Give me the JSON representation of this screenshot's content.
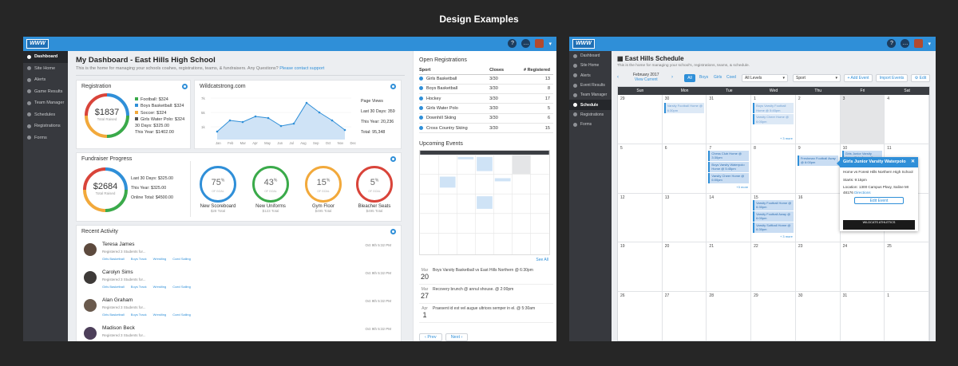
{
  "heading": "Design Examples",
  "dashboard": {
    "logo": "WWW",
    "nav": [
      {
        "label": "Dashboard",
        "active": true
      },
      {
        "label": "Site Home"
      },
      {
        "label": "Alerts"
      },
      {
        "label": "Game Results"
      },
      {
        "label": "Team Manager"
      },
      {
        "label": "Schedules"
      },
      {
        "label": "Registrations"
      },
      {
        "label": "Forms"
      }
    ],
    "title": "My Dashboard - East Hills High School",
    "subtitle": "This is the home for managing your schools coahes, registrations, teams, & fundraisers. Any Questions?",
    "subtitle_link": "Please contact support",
    "registration": {
      "title": "Registration",
      "total": "$1837",
      "total_label": "Total Raised",
      "legend": [
        {
          "label": "Football: $324",
          "color": "#3aaa4a"
        },
        {
          "label": "Boys Basketball: $324",
          "color": "#2f8fd8"
        },
        {
          "label": "Soccer: $324",
          "color": "#f2a93b"
        },
        {
          "label": "Girls Water Polo: $324",
          "color": "#555555"
        }
      ],
      "last30": "30 Days: $325.00",
      "thisyear": "This Year: $1402.00"
    },
    "wildcat": {
      "title": "Wildcatstrong.com",
      "y_ticks": [
        "7k",
        "5k",
        "1k"
      ],
      "months": [
        "Jan",
        "Feb",
        "Mar",
        "Apr",
        "May",
        "Jun",
        "Jul",
        "Aug",
        "Sep",
        "Oct",
        "Nov",
        "Dec"
      ],
      "stats_title": "Page Views",
      "stat_rows": [
        "Last 30 Days: 359",
        "This Year: 20,236",
        "Total: 95,348"
      ]
    },
    "fundraiser": {
      "title": "Fundraiser Progress",
      "total": "$2684",
      "total_label": "Total Raised",
      "rows": [
        "Last 30 Days: $325.00",
        "This Year: $325.00",
        "Online Total: $4500.00"
      ],
      "goals": [
        {
          "pct": "75",
          "name": "New Scoreboard",
          "total": "$28 Total",
          "color": "#2f8fd8"
        },
        {
          "pct": "43",
          "name": "New Uniforms",
          "total": "$123 Total",
          "color": "#3aaa4a"
        },
        {
          "pct": "15",
          "name": "Gym Floor",
          "total": "$495 Total",
          "color": "#f2a93b"
        },
        {
          "pct": "5",
          "name": "Bleacher Seats",
          "total": "$495 Total",
          "color": "#d9443a"
        }
      ],
      "of_goal": "OF GOAL",
      "pct_sign": "%"
    },
    "activity": {
      "title": "Recent Activity",
      "items": [
        {
          "name": "Teresa James",
          "desc": "Registered 3 Students for...",
          "date": "Oct 9th 5:32 PM",
          "tags": [
            "Girls Basketball",
            "Boys Track",
            "Wrestling",
            "Coed Sailing"
          ]
        },
        {
          "name": "Carolyn Sims",
          "desc": "Registered 3 Students for...",
          "date": "Oct 9th 5:32 PM",
          "tags": [
            "Girls Basketball",
            "Boys Track",
            "Wrestling",
            "Coed Sailing"
          ]
        },
        {
          "name": "Alan Graham",
          "desc": "Registered 3 Students for...",
          "date": "Oct 9th 5:32 PM",
          "tags": [
            "Girls Basketball",
            "Boys Track",
            "Wrestling",
            "Coed Sailing"
          ]
        },
        {
          "name": "Madison Beck",
          "desc": "Registered 3 Students for...",
          "date": "Oct 9th 5:32 PM",
          "tags": []
        }
      ]
    },
    "open_reg": {
      "title": "Open Registrations",
      "headers": [
        "Sport",
        "Closes",
        "# Registered"
      ],
      "rows": [
        {
          "sport": "Girls Basketball",
          "closes": "3/30",
          "count": "13"
        },
        {
          "sport": "Boys Basketball",
          "closes": "3/30",
          "count": "8"
        },
        {
          "sport": "Hockey",
          "closes": "3/30",
          "count": "17"
        },
        {
          "sport": "Girls Water Polo",
          "closes": "3/30",
          "count": "5"
        },
        {
          "sport": "Downhill Skiing",
          "closes": "3/30",
          "count": "6"
        },
        {
          "sport": "Cross Country Skiing",
          "closes": "3/30",
          "count": "15"
        }
      ]
    },
    "upcoming": {
      "title": "Upcoming Events",
      "see_all": "See All",
      "events": [
        {
          "mon": "Mar",
          "day": "20",
          "text": "Boys Varsity Basketball vs East Hills Northern @ 6:30pm"
        },
        {
          "mon": "Mar",
          "day": "27",
          "text": "Recovery brunch @ annul shouse. @ 2:00pm"
        },
        {
          "mon": "Apr",
          "day": "1",
          "text": "Praesent id est vel augue ultrices semper in el. @ 5:30am"
        }
      ],
      "prev": "Prev",
      "next": "Next"
    }
  },
  "schedule": {
    "nav": [
      {
        "label": "Dashboard"
      },
      {
        "label": "Site Home"
      },
      {
        "label": "Alerts"
      },
      {
        "label": "Event Results"
      },
      {
        "label": "Team Manager"
      },
      {
        "label": "Schedule",
        "active": true
      },
      {
        "label": "Registrations"
      },
      {
        "label": "Forms"
      }
    ],
    "title": "East Hills Schedule",
    "subtitle": "This is the home for managing your school's, registrations, teams, & schedule.",
    "month": "February 2017",
    "view_current": "View Current",
    "filters": [
      "All",
      "Boys",
      "Girls",
      "Coed"
    ],
    "levels": "All Levels",
    "sport": "Sport",
    "add_event": "+ Add Event",
    "import_events": "Import Events",
    "edit": "Edit",
    "days": [
      "Sun",
      "Mon",
      "Tue",
      "Wed",
      "Thu",
      "Fri",
      "Sat"
    ],
    "dates": [
      "29",
      "30",
      "31",
      "1",
      "2",
      "3",
      "4",
      "5",
      "6",
      "7",
      "8",
      "9",
      "10",
      "11",
      "12",
      "13",
      "14",
      "15",
      "16",
      "17",
      "18",
      "19",
      "20",
      "21",
      "22",
      "23",
      "24",
      "25",
      "26",
      "27",
      "28",
      "29",
      "30",
      "31",
      "1"
    ],
    "events": {
      "e1": "Varsity Football Home @ 6:30pm",
      "e2": "Girls Junior Varsity Water Polo Away @ 5:30pm",
      "e3": "Boys Varsity Football Home @ 5:45pm",
      "e4": "Varsity Cheer Home @ 6:00pm",
      "e5": "Chess Club Home @ 3:30pm",
      "e6": "Boys Varsity Waterpolo Home @ 5:45pm",
      "e7": "Varsity Cheer Home @ 6:00pm",
      "e8": "Freshman Football Away @ 6:00pm",
      "e9": "Varsity Football Home @ 6:30pm",
      "e10": "Varsity Football Away @ 6:00pm",
      "e11": "Varsity Softball Home @ 6:30pm",
      "more1": "+ 3 more",
      "more2": "+3 more",
      "more3": "+ 3 more"
    },
    "popover": {
      "title": "Girls Junior Varsity Waterpolo",
      "line1": "Home vs Forest Hills Northern High School",
      "starts": "Starts: 9:15pm",
      "location": "Location: 1300 Campus Pkwy, Saline MI 48176",
      "directions": "Directions",
      "button": "Edit Event",
      "ad": "WILDCATS ATHLETICS"
    }
  }
}
